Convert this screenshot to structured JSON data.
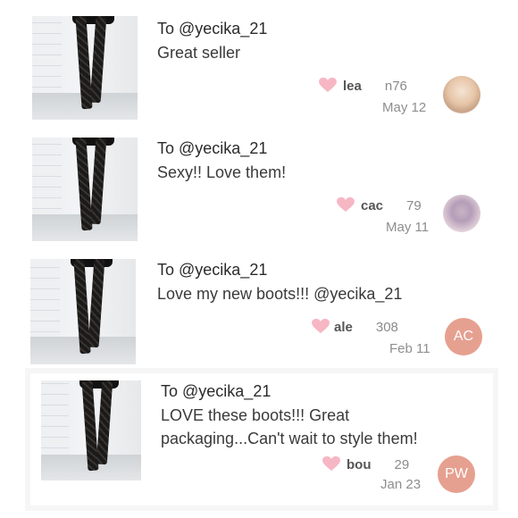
{
  "reviews": [
    {
      "to": "To @yecika_21",
      "message": "Great seller",
      "user_start": "lea",
      "user_end": "n76",
      "date": "May 12",
      "avatar_initials": ""
    },
    {
      "to": "To @yecika_21",
      "message": "Sexy!! Love them!",
      "user_start": "cac",
      "user_end": "79",
      "date": "May 11",
      "avatar_initials": ""
    },
    {
      "to": "To @yecika_21",
      "message": "Love my new boots!!! @yecika_21",
      "user_start": "ale",
      "user_end": "308",
      "date": "Feb 11",
      "avatar_initials": "AC"
    },
    {
      "to": "To @yecika_21",
      "message_line1": "LOVE these boots!!! Great",
      "message_line2": "packaging...Can't wait to style them!",
      "user_start": "bou",
      "user_end": "29",
      "date": "Jan 23",
      "avatar_initials": "PW"
    }
  ],
  "icons": {
    "heart": "heart-icon",
    "thumbnail": "boots-photo"
  },
  "colors": {
    "heart": "#f7b6c4",
    "avatar_initials_bg": "#e6a090"
  }
}
